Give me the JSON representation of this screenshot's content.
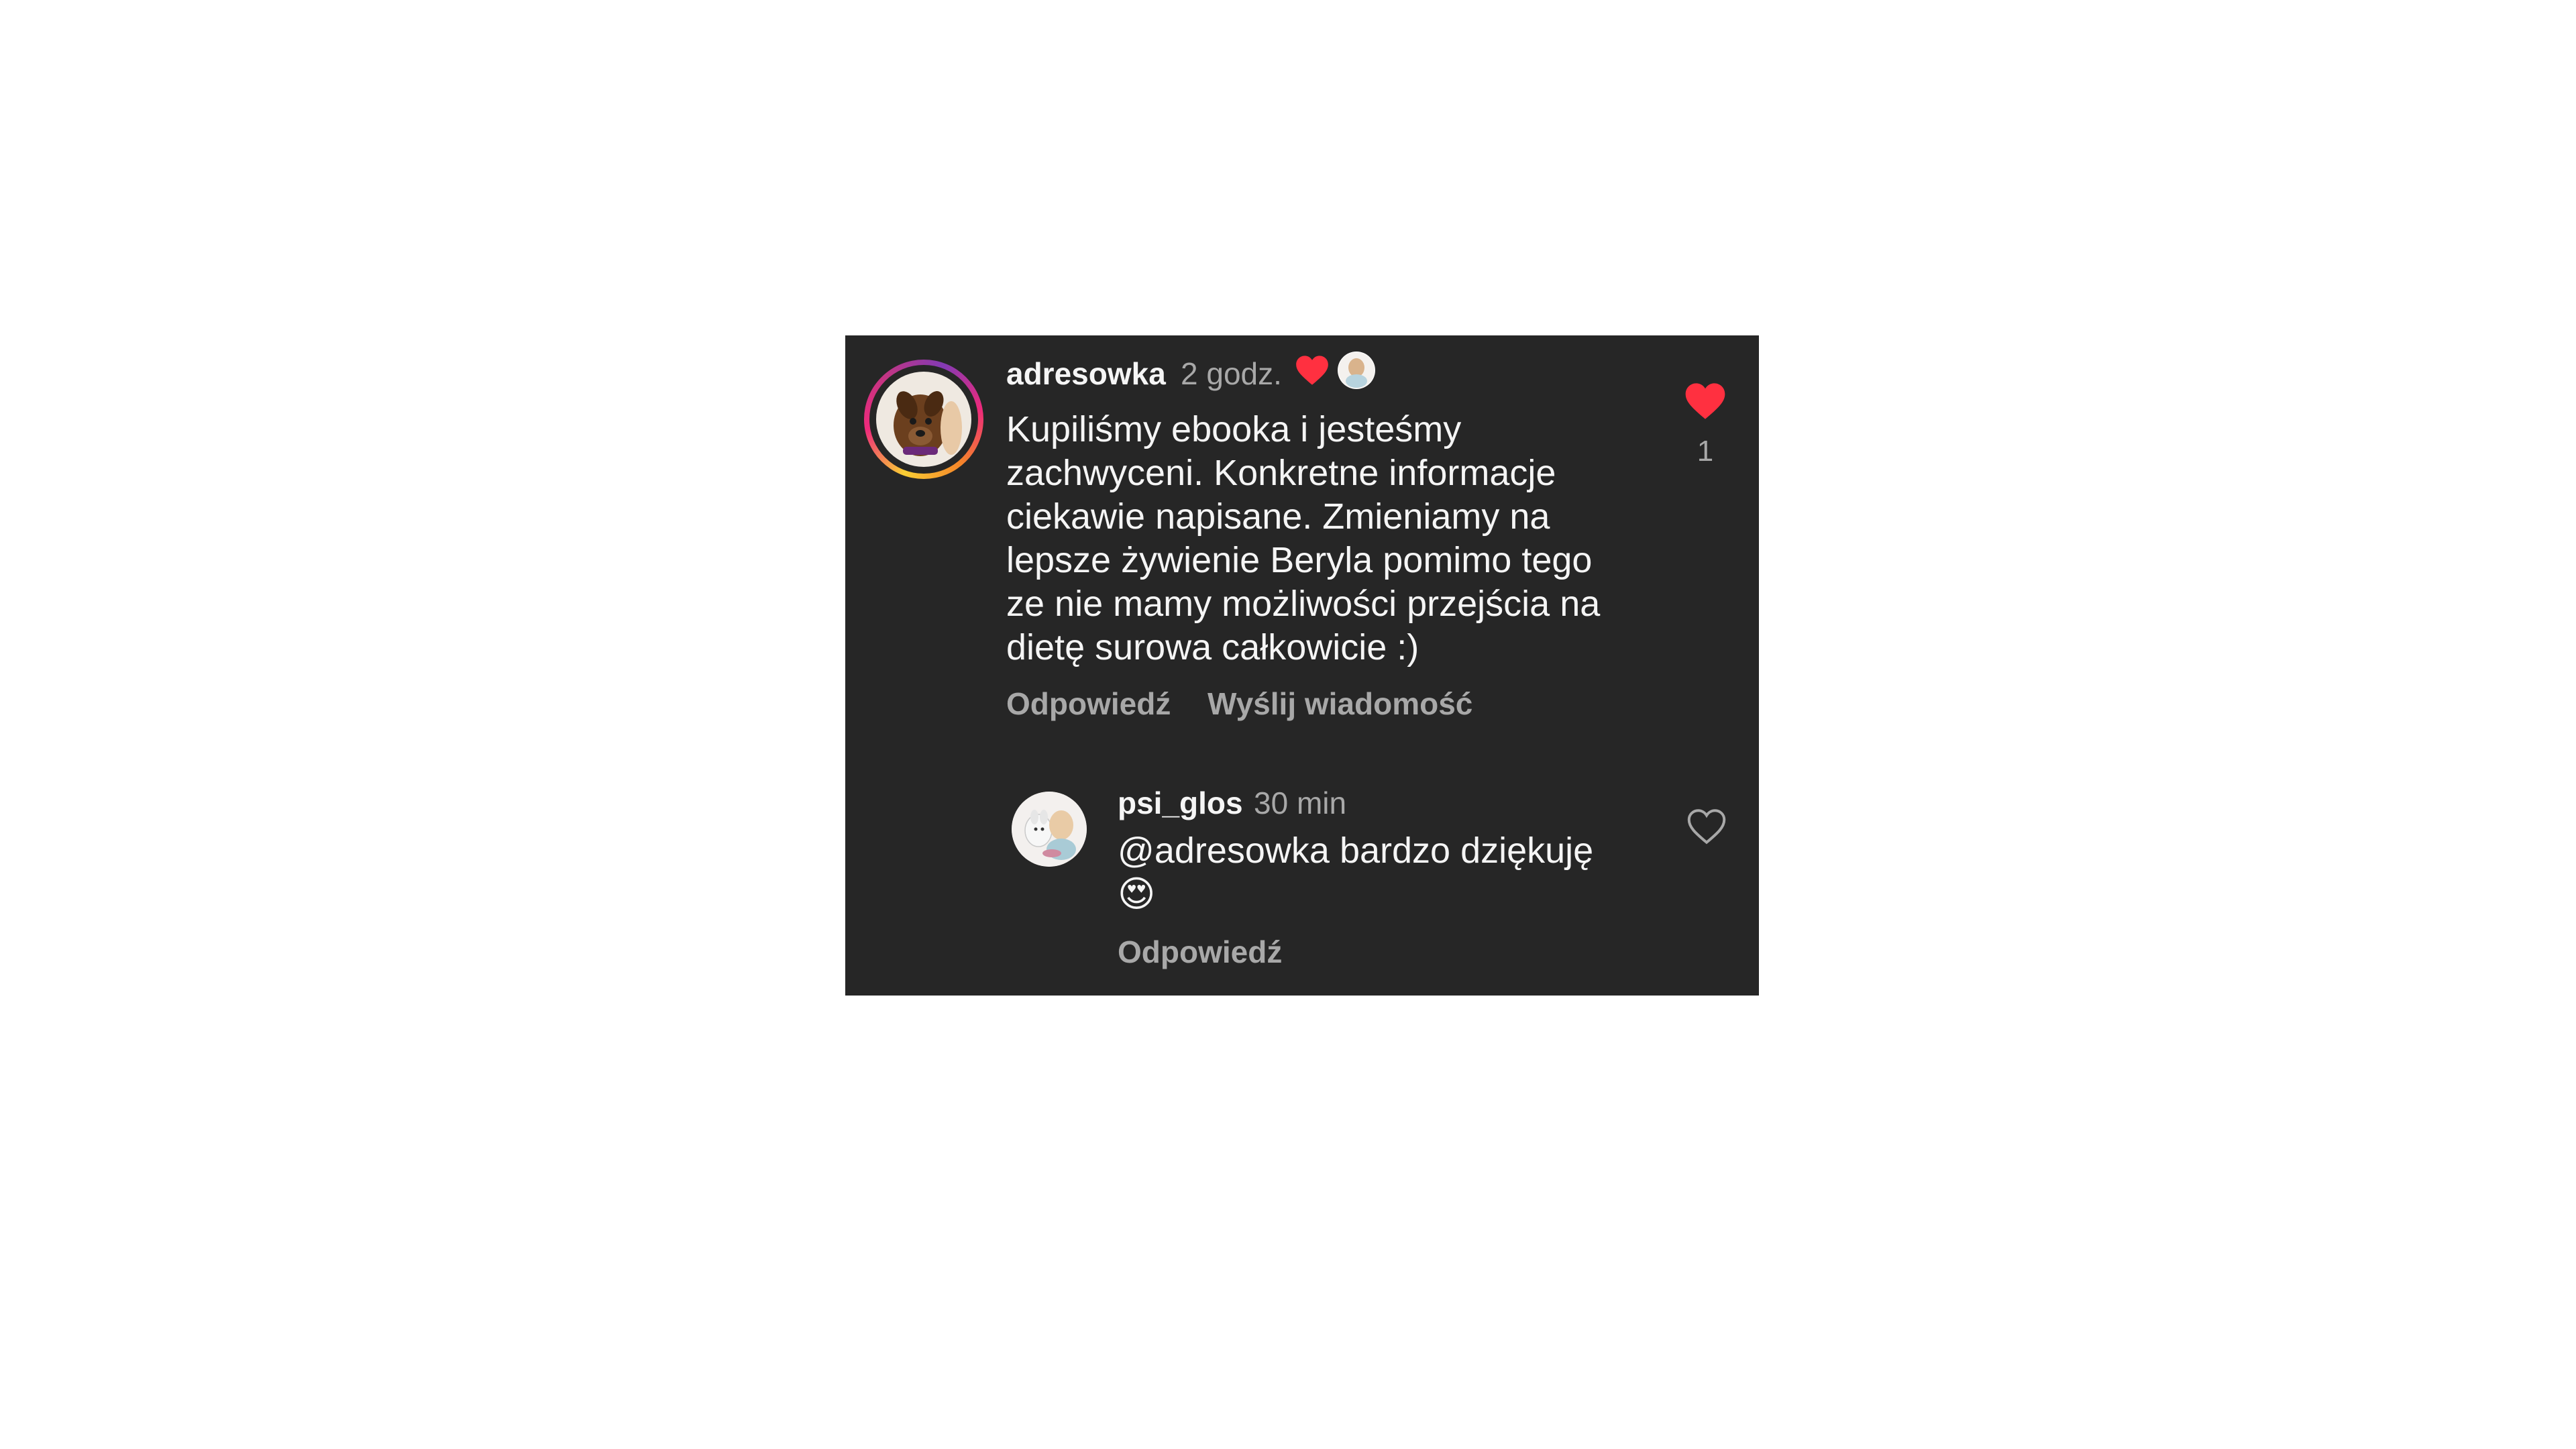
{
  "comments": [
    {
      "username": "adresowka",
      "time": "2 godz.",
      "text_lines": [
        "Kupiliśmy ebooka i jesteśmy",
        "zachwyceni. Konkretne informacje",
        "ciekawie napisane. Zmieniamy na",
        "lepsze żywienie Beryla pomimo tego",
        "ze nie mamy możliwości przejścia na",
        "dietę surowa całkowicie :)"
      ],
      "reply_label": "Odpowiedź",
      "send_message_label": "Wyślij wiadomość",
      "likes": "1",
      "liked": true,
      "author_liked": true,
      "has_story_ring": true
    },
    {
      "username": "psi_glos",
      "time": "30 min",
      "text_lines": [
        "@adresowka bardzo dziękuję",
        "😍"
      ],
      "reply_label": "Odpowiedź",
      "liked": false
    }
  ],
  "icons": {
    "heart_filled": "heart-filled-icon",
    "heart_outline": "heart-outline-icon"
  },
  "colors": {
    "background": "#262626",
    "like_red": "#ff3040",
    "primary_text": "#f5f5f5",
    "secondary_text": "#a8a8a8"
  }
}
